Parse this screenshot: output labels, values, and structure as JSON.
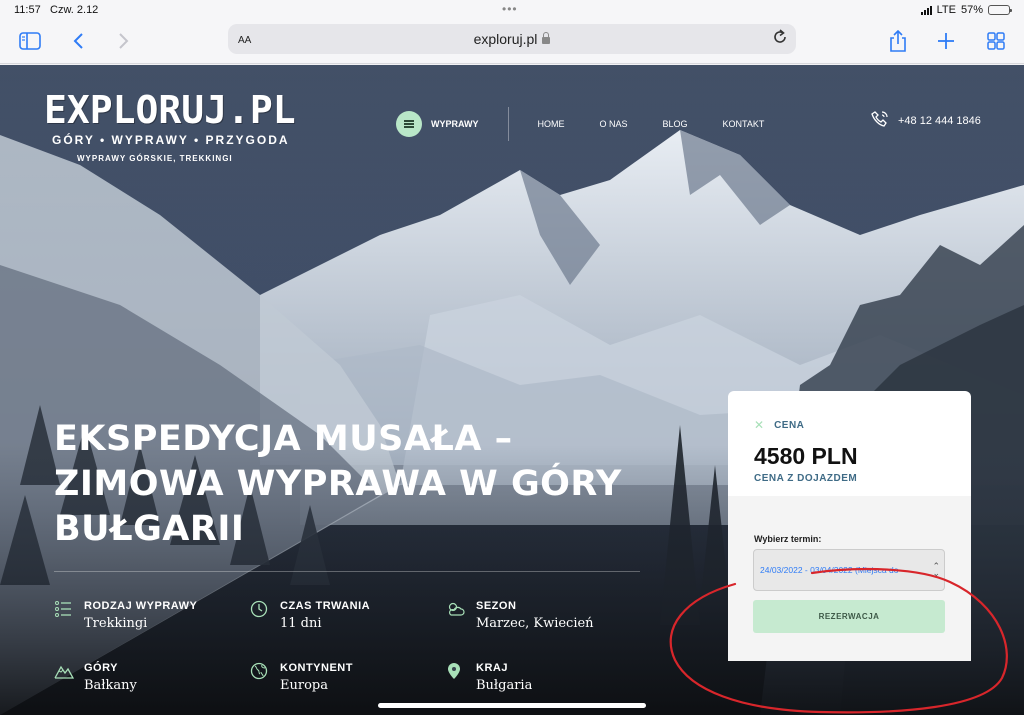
{
  "status_bar": {
    "time": "11:57",
    "date": "Czw. 2.12",
    "network": "LTE",
    "battery_percent": "57%",
    "battery_level": 0.57
  },
  "toolbar": {
    "text_size_label": "AA",
    "url": "exploruj.pl",
    "icons": [
      "sidebar-icon",
      "back-icon",
      "forward-icon",
      "lock-icon",
      "reload-icon",
      "share-icon",
      "plus-icon",
      "tabs-icon"
    ]
  },
  "site": {
    "logo": "EXPLORUJ.PL",
    "tagline": "GÓRY • WYPRAWY • PRZYGODA",
    "subtagline": "WYPRAWY GÓRSKIE, TREKKINGI",
    "nav": {
      "wyprawy": "WYPRAWY",
      "links": [
        "HOME",
        "O NAS",
        "BLOG",
        "KONTAKT"
      ]
    },
    "phone": "+48 12 444 1846"
  },
  "hero": {
    "title_lines": [
      "EKSPEDYCJA MUSAŁA –",
      "ZIMOWA WYPRAWA W GÓRY",
      "BUŁGARII"
    ],
    "facts": [
      {
        "label": "RODZAJ WYPRAWY",
        "value": "Trekkingi",
        "icon": "list-icon"
      },
      {
        "label": "CZAS TRWANIA",
        "value": "11 dni",
        "icon": "clock-icon"
      },
      {
        "label": "SEZON",
        "value": "Marzec, Kwiecień",
        "icon": "weather-icon"
      },
      {
        "label": "GÓRY",
        "value": "Bałkany",
        "icon": "mountain-icon"
      },
      {
        "label": "KONTYNENT",
        "value": "Europa",
        "icon": "globe-icon"
      },
      {
        "label": "KRAJ",
        "value": "Bułgaria",
        "icon": "location-pin-icon"
      }
    ]
  },
  "price_card": {
    "label": "CENA",
    "price": "4580 PLN",
    "price_note": "CENA Z DOJAZDEM",
    "term_label": "Wybierz termin:",
    "selected_term": "24/03/2022 - 03/04/2022 (Miejsca do",
    "reserve_button": "REZERWACJA"
  },
  "colors": {
    "accent_green": "#b9e7c8",
    "annotation_red": "#d8262b",
    "link_blue": "#2f7cf6",
    "label_blue": "#3f6b86"
  }
}
